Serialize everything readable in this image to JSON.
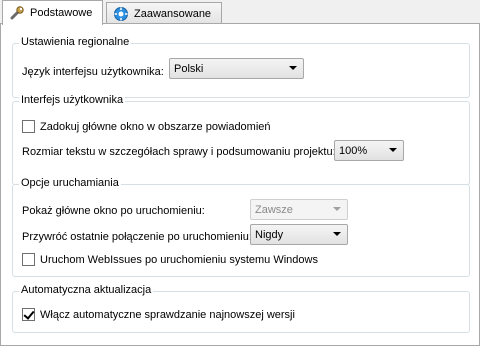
{
  "tabs": [
    {
      "label": "Podstawowe",
      "icon": "wrench-icon"
    },
    {
      "label": "Zaawansowane",
      "icon": "gear-icon"
    }
  ],
  "regional": {
    "title": "Ustawienia regionalne",
    "language_label": "Język interfejsu użytkownika:",
    "language_value": "Polski"
  },
  "ui": {
    "title": "Interfejs użytkownika",
    "dock_label": "Zadokuj główne okno w obszarze powiadomień",
    "dock_checked": false,
    "text_size_label": "Rozmiar tekstu w szczegółach sprawy i podsumowaniu projektu:",
    "text_size_value": "100%"
  },
  "startup": {
    "title": "Opcje uruchamiania",
    "show_label": "Pokaż główne okno po uruchomieniu:",
    "show_value": "Zawsze",
    "restore_label": "Przywróć ostatnie połączenie po uruchomieniu:",
    "restore_value": "Nigdy",
    "autostart_label": "Uruchom WebIssues po uruchomieniu systemu Windows",
    "autostart_checked": false
  },
  "update": {
    "title": "Automatyczna aktualizacja",
    "check_label": "Włącz automatyczne sprawdzanie najnowszej wersji",
    "check_checked": true
  }
}
